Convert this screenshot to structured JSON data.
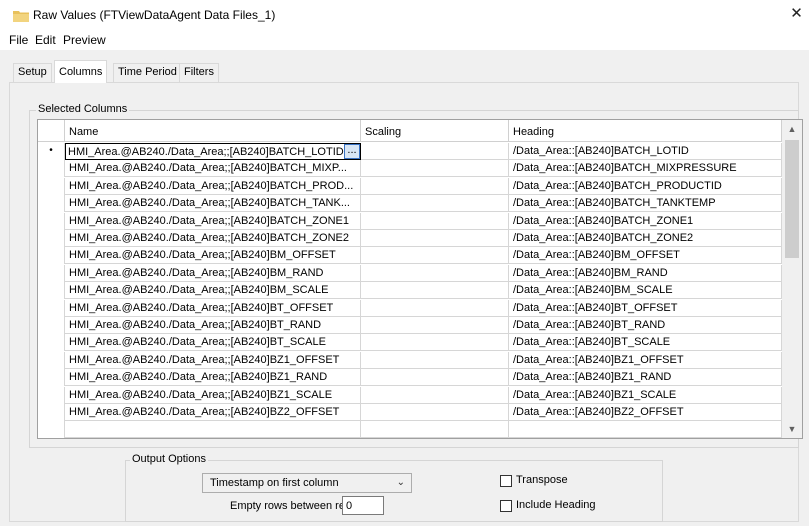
{
  "window": {
    "title": "Raw Values (FTViewDataAgent Data Files_1)",
    "close_symbol": "✕",
    "folder_color": "#e8c15c"
  },
  "menu": [
    "File",
    "Edit",
    "Preview"
  ],
  "tabs": [
    {
      "label": "Setup",
      "active": false
    },
    {
      "label": "Columns",
      "active": true
    },
    {
      "label": "Time Period",
      "active": false
    },
    {
      "label": "Filters",
      "active": false
    }
  ],
  "selected_columns": {
    "legend": "Selected Columns",
    "headers": [
      "Name",
      "Scaling",
      "Heading"
    ],
    "current_row_marker": "•",
    "edit_button_label": "...",
    "rows": [
      {
        "name": "HMI_Area.@AB240./Data_Area;;[AB240]BATCH_LOTID",
        "scaling": "",
        "heading": "/Data_Area::[AB240]BATCH_LOTID"
      },
      {
        "name": "HMI_Area.@AB240./Data_Area;;[AB240]BATCH_MIXP...",
        "scaling": "",
        "heading": "/Data_Area::[AB240]BATCH_MIXPRESSURE"
      },
      {
        "name": "HMI_Area.@AB240./Data_Area;;[AB240]BATCH_PROD...",
        "scaling": "",
        "heading": "/Data_Area::[AB240]BATCH_PRODUCTID"
      },
      {
        "name": "HMI_Area.@AB240./Data_Area;;[AB240]BATCH_TANK...",
        "scaling": "",
        "heading": "/Data_Area::[AB240]BATCH_TANKTEMP"
      },
      {
        "name": "HMI_Area.@AB240./Data_Area;;[AB240]BATCH_ZONE1",
        "scaling": "",
        "heading": "/Data_Area::[AB240]BATCH_ZONE1"
      },
      {
        "name": "HMI_Area.@AB240./Data_Area;;[AB240]BATCH_ZONE2",
        "scaling": "",
        "heading": "/Data_Area::[AB240]BATCH_ZONE2"
      },
      {
        "name": "HMI_Area.@AB240./Data_Area;;[AB240]BM_OFFSET",
        "scaling": "",
        "heading": "/Data_Area::[AB240]BM_OFFSET"
      },
      {
        "name": "HMI_Area.@AB240./Data_Area;;[AB240]BM_RAND",
        "scaling": "",
        "heading": "/Data_Area::[AB240]BM_RAND"
      },
      {
        "name": "HMI_Area.@AB240./Data_Area;;[AB240]BM_SCALE",
        "scaling": "",
        "heading": "/Data_Area::[AB240]BM_SCALE"
      },
      {
        "name": "HMI_Area.@AB240./Data_Area;;[AB240]BT_OFFSET",
        "scaling": "",
        "heading": "/Data_Area::[AB240]BT_OFFSET"
      },
      {
        "name": "HMI_Area.@AB240./Data_Area;;[AB240]BT_RAND",
        "scaling": "",
        "heading": "/Data_Area::[AB240]BT_RAND"
      },
      {
        "name": "HMI_Area.@AB240./Data_Area;;[AB240]BT_SCALE",
        "scaling": "",
        "heading": "/Data_Area::[AB240]BT_SCALE"
      },
      {
        "name": "HMI_Area.@AB240./Data_Area;;[AB240]BZ1_OFFSET",
        "scaling": "",
        "heading": "/Data_Area::[AB240]BZ1_OFFSET"
      },
      {
        "name": "HMI_Area.@AB240./Data_Area;;[AB240]BZ1_RAND",
        "scaling": "",
        "heading": "/Data_Area::[AB240]BZ1_RAND"
      },
      {
        "name": "HMI_Area.@AB240./Data_Area;;[AB240]BZ1_SCALE",
        "scaling": "",
        "heading": "/Data_Area::[AB240]BZ1_SCALE"
      },
      {
        "name": "HMI_Area.@AB240./Data_Area;;[AB240]BZ2_OFFSET",
        "scaling": "",
        "heading": "/Data_Area::[AB240]BZ2_OFFSET"
      }
    ]
  },
  "output_options": {
    "legend": "Output Options",
    "timestamp_select": {
      "selected": "Timestamp on first column"
    },
    "empty_rows_label": "Empty rows between records",
    "empty_rows_value": "0",
    "transpose_label": "Transpose",
    "transpose_checked": false,
    "include_heading_label": "Include Heading",
    "include_heading_checked": false
  }
}
